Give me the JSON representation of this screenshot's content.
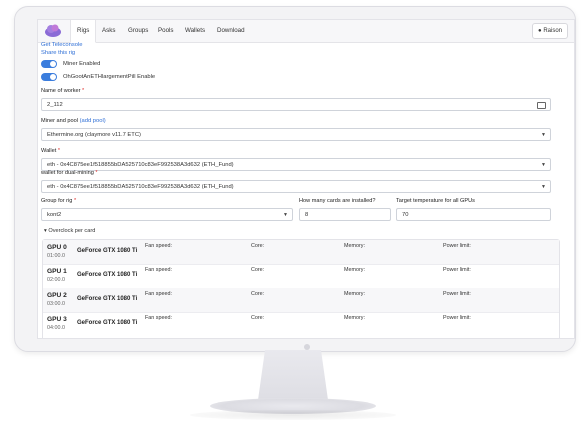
{
  "nav": {
    "tabs": [
      "Rigs",
      "Asks",
      "Groups",
      "Pools",
      "Wallets",
      "Download"
    ],
    "active_tab": "Rigs",
    "user": "Raison"
  },
  "links": {
    "teleconsole": "Get Teleconsole",
    "share": "Share this rig"
  },
  "toggles": [
    {
      "label": "Miner Enabled",
      "on": true
    },
    {
      "label": "OhGootAnETHlargementPill Enable",
      "on": true
    }
  ],
  "form": {
    "worker_label": "Name of worker",
    "worker_value": "2_112",
    "miner_label": "Miner and pool",
    "miner_add": "(add pool)",
    "miner_value": "Ethermine.org (claymore v11.7 ETC)",
    "wallet_label": "Wallet",
    "wallet_value": "eth - 0x4C875ee1f518855bDA525710c83eF992538A3d632 (ETH_Fund)",
    "dual_label": "wallet for dual-mining",
    "dual_value": "eth - 0x4C875ee1f518855bDA525710c83eF992538A3d632 (ETH_Fund)",
    "group_label": "Group for rig",
    "group_value": "kont2",
    "cards_label": "How many cards are installed?",
    "cards_value": "8",
    "temp_label": "Target temperature for all GPUs",
    "temp_value": "70",
    "overclock_label": "Overclock per card"
  },
  "gpu_columns": {
    "fan": "Fan speed:",
    "core": "Core:",
    "memory": "Memory:",
    "power": "Power limit:"
  },
  "gpus": [
    {
      "name": "GPU 0",
      "id": "01:00.0",
      "model": "GeForce GTX 1080 Ti"
    },
    {
      "name": "GPU 1",
      "id": "02:00.0",
      "model": "GeForce GTX 1080 Ti"
    },
    {
      "name": "GPU 2",
      "id": "03:00.0",
      "model": "GeForce GTX 1080 Ti"
    },
    {
      "name": "GPU 3",
      "id": "04:00.0",
      "model": "GeForce GTX 1080 Ti"
    }
  ],
  "colors": {
    "accent": "#3b7ddd",
    "link": "#2f6fd6",
    "required": "#e0322e"
  }
}
